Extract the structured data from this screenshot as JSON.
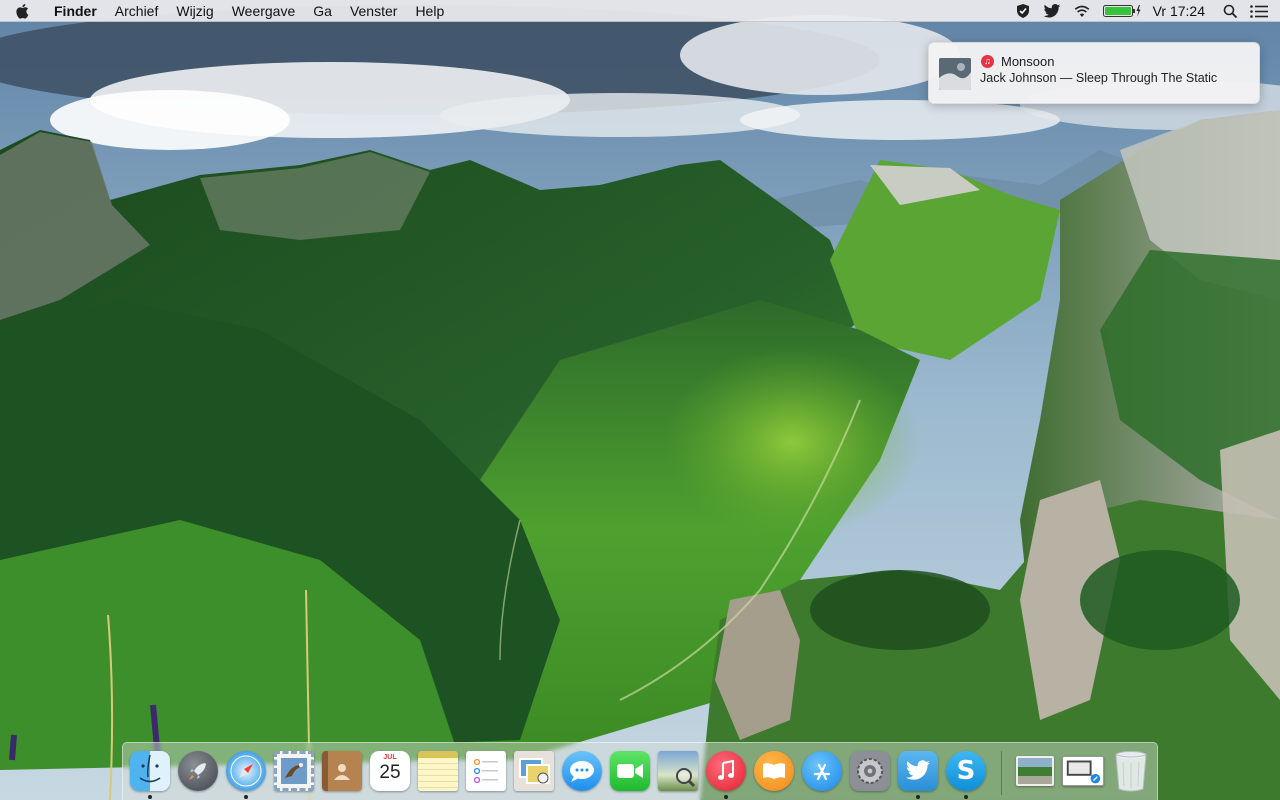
{
  "menubar": {
    "apple_icon": "apple-logo-icon",
    "app_name": "Finder",
    "menus": [
      "Archief",
      "Wijzig",
      "Weergave",
      "Ga",
      "Venster",
      "Help"
    ],
    "status": {
      "icons": [
        "notification-center-shield-icon",
        "twitter-bird-icon",
        "wifi-icon",
        "battery-charging-icon",
        "spotlight-search-icon",
        "notification-list-icon"
      ],
      "battery_color": "#38c338",
      "clock": "Vr 17:24"
    }
  },
  "notification": {
    "app_icon": "itunes-note-icon",
    "title": "Monsoon",
    "body": "Jack Johnson — Sleep Through The Static"
  },
  "dock": {
    "items": [
      {
        "name": "finder",
        "icon": "finder-face-icon",
        "running": true
      },
      {
        "name": "launchpad",
        "icon": "launchpad-rocket-icon",
        "running": false
      },
      {
        "name": "safari",
        "icon": "safari-compass-icon",
        "running": true
      },
      {
        "name": "mail",
        "icon": "mail-stamp-eagle-icon",
        "running": false
      },
      {
        "name": "contacts",
        "icon": "contacts-book-icon",
        "running": false
      },
      {
        "name": "calendar",
        "icon": "calendar-icon",
        "running": false,
        "month": "JUL",
        "day": "25"
      },
      {
        "name": "notes",
        "icon": "notes-icon",
        "running": false
      },
      {
        "name": "reminders",
        "icon": "reminders-list-icon",
        "running": false
      },
      {
        "name": "preview",
        "icon": "preview-photos-icon",
        "running": false
      },
      {
        "name": "messages",
        "icon": "messages-bubble-icon",
        "running": false
      },
      {
        "name": "facetime",
        "icon": "facetime-camera-icon",
        "running": false
      },
      {
        "name": "photo-browser",
        "icon": "image-magnifier-icon",
        "running": false
      },
      {
        "name": "itunes",
        "icon": "itunes-note-icon",
        "running": true
      },
      {
        "name": "ibooks",
        "icon": "ibooks-open-book-icon",
        "running": false
      },
      {
        "name": "app-store",
        "icon": "app-store-a-icon",
        "running": false
      },
      {
        "name": "system-preferences",
        "icon": "system-preferences-gear-icon",
        "running": false
      },
      {
        "name": "twitter",
        "icon": "twitter-bird-icon",
        "running": true
      },
      {
        "name": "skype",
        "icon": "skype-s-icon",
        "running": true
      },
      {
        "name": "screenshot-stack",
        "icon": "mountain-screenshot-icon",
        "running": false
      },
      {
        "name": "preview-document",
        "icon": "preview-document-icon",
        "running": false
      },
      {
        "name": "trash",
        "icon": "trash-can-icon",
        "running": false
      }
    ]
  }
}
